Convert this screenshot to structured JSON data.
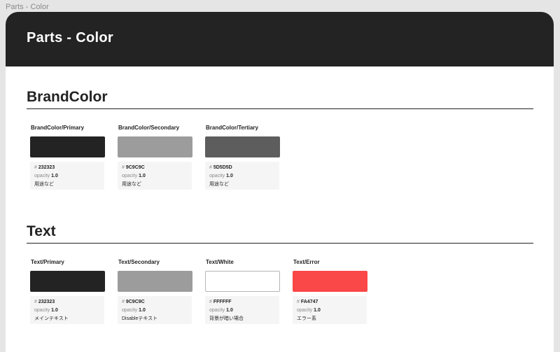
{
  "tab_title": "Parts - Color",
  "header": {
    "title": "Parts - Color"
  },
  "info_labels": {
    "hash": "#",
    "opacity": "opacity"
  },
  "sections": [
    {
      "title": "BrandColor",
      "swatches": [
        {
          "name": "BrandColor/Primary",
          "hex": "232323",
          "color": "#232323",
          "opacity": "1.0",
          "usage": "用途など"
        },
        {
          "name": "BrandColor/Secondary",
          "hex": "9C9C9C",
          "color": "#9C9C9C",
          "opacity": "1.0",
          "usage": "用途など"
        },
        {
          "name": "BrandColor/Tertiary",
          "hex": "5D5D5D",
          "color": "#5D5D5D",
          "opacity": "1.0",
          "usage": "用途など"
        }
      ]
    },
    {
      "title": "Text",
      "swatches": [
        {
          "name": "Text/Primary",
          "hex": "232323",
          "color": "#232323",
          "opacity": "1.0",
          "usage": "メインテキスト"
        },
        {
          "name": "Text/Secondary",
          "hex": "9C9C9C",
          "color": "#9C9C9C",
          "opacity": "1.0",
          "usage": "Disableテキスト"
        },
        {
          "name": "Text/White",
          "hex": "FFFFFF",
          "color": "#FFFFFF",
          "opacity": "1.0",
          "usage": "背景が暗い場合"
        },
        {
          "name": "Text/Error",
          "hex": "FA4747",
          "color": "#FA4747",
          "opacity": "1.0",
          "usage": "エラー系"
        }
      ]
    }
  ]
}
